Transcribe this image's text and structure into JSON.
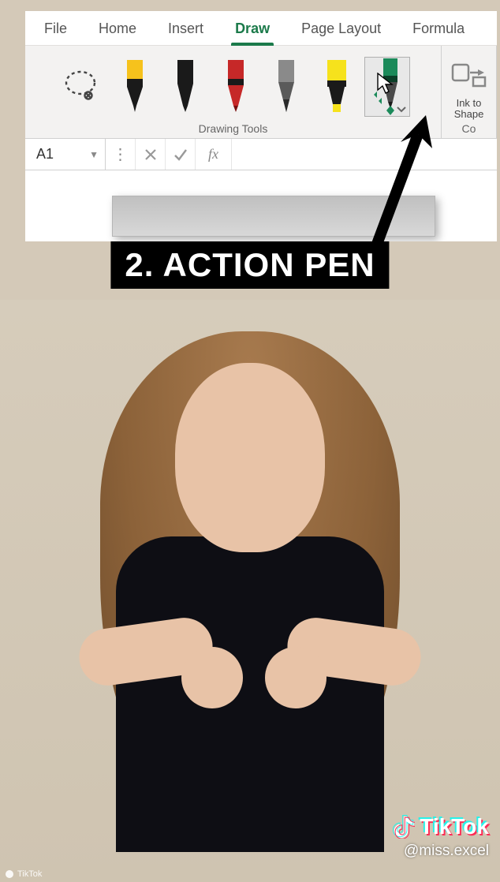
{
  "caption": "2. ACTION PEN",
  "tabs": [
    "File",
    "Home",
    "Insert",
    "Draw",
    "Page Layout",
    "Formula"
  ],
  "active_tab_index": 3,
  "ribbon": {
    "drawing_tools_label": "Drawing Tools",
    "convert_label": "Co",
    "ink_to_shape_label_line1": "Ink to",
    "ink_to_shape_label_line2": "Shape",
    "tools": [
      "lasso",
      "pen-yellow",
      "pen-black",
      "pen-red",
      "pencil",
      "highlighter-yellow",
      "action-pen"
    ],
    "pen_colors": {
      "pen-yellow": {
        "body": "#f6c21c",
        "tip": "#1a1a1a",
        "band": "#1a1a1a"
      },
      "pen-black": {
        "body": "#1a1a1a",
        "tip": "#1a1a1a",
        "band": "#3a3a3a"
      },
      "pen-red": {
        "body": "#c62828",
        "tip": "#8b1a1a",
        "band": "#1a1a1a"
      },
      "pencil": {
        "body": "#8a8a8a",
        "tip": "#4a4a4a",
        "band": "#6a6a6a"
      },
      "highlighter-yellow": {
        "body": "#f6e21c",
        "tip": "#f6e21c",
        "band": "#1a1a1a"
      },
      "action-pen": {
        "body": "#1b8a5a",
        "tip": "#0f5c3a",
        "band": "#0b3f28"
      }
    }
  },
  "formula_bar": {
    "namebox_value": "A1",
    "fx_label": "fx"
  },
  "watermark": {
    "brand": "TikTok",
    "handle": "@miss.excel",
    "source": "TikTok"
  }
}
